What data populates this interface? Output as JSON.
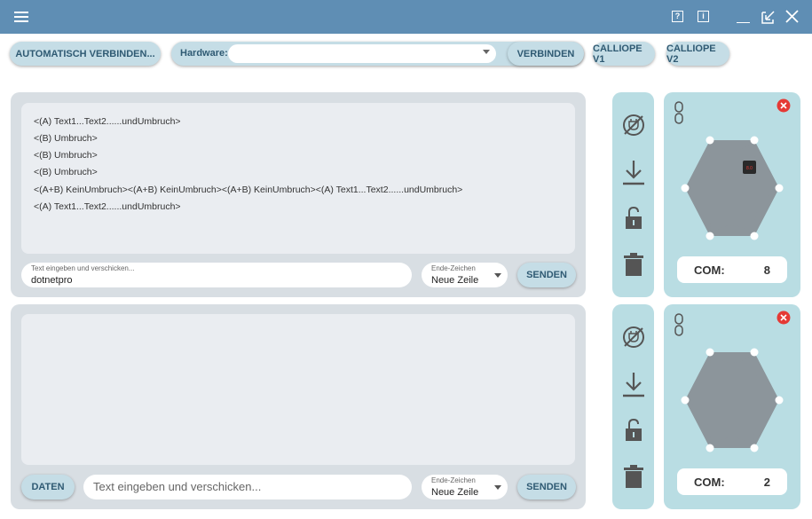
{
  "titlebar": {
    "menu_icon": "hamburger-icon",
    "help_icon": "help-icon",
    "help_glyph": "?",
    "info_icon": "info-icon",
    "info_glyph": "i",
    "minimize_icon": "minimize-icon",
    "restore_icon": "restore-icon",
    "close_icon": "close-icon"
  },
  "toolbar": {
    "auto_connect_label": "AUTOMATISCH VERBINDEN...",
    "hardware_label": "Hardware:",
    "hardware_value": "",
    "connect_label": "VERBINDEN",
    "calliope_v1_label": "CALLIOPE V1",
    "calliope_v2_label": "CALLIOPE V2"
  },
  "panel1": {
    "lines": [
      "<(A) Text1...Text2......undUmbruch>",
      "<(B) Umbruch>",
      "<(B) Umbruch>",
      "<(B) Umbruch>",
      "<(A+B) KeinUmbruch><(A+B) KeinUmbruch><(A+B) KeinUmbruch><(A) Text1...Text2......undUmbruch>",
      "<(A) Text1...Text2......undUmbruch>"
    ],
    "input_label": "Text eingeben und verschicken...",
    "input_value": "dotnetpro",
    "end_label": "Ende-Zeichen",
    "end_value": "Neue Zeile",
    "send_label": "SENDEN"
  },
  "panel2": {
    "lines": [],
    "data_label": "DATEN",
    "input_placeholder": "Text eingeben und verschicken...",
    "end_label": "Ende-Zeichen",
    "end_value": "Neue Zeile",
    "send_label": "SENDEN"
  },
  "device1": {
    "com_label": "COM:",
    "com_value": "8",
    "chip_text": "8.0",
    "icons": [
      "unplug-icon",
      "download-icon",
      "unlock-icon",
      "trash-icon",
      "link-icon",
      "close-circle-icon"
    ]
  },
  "device2": {
    "com_label": "COM:",
    "com_value": "2",
    "icons": [
      "unplug-icon",
      "download-icon",
      "unlock-icon",
      "trash-icon",
      "link-icon",
      "close-circle-icon"
    ]
  },
  "colors": {
    "titlebar": "#5f8eb4",
    "button_bg": "#c5dde6",
    "button_text": "#2f5a73",
    "side_bg": "#b9dde3",
    "board": "#8c959b",
    "close_red": "#e53935"
  }
}
